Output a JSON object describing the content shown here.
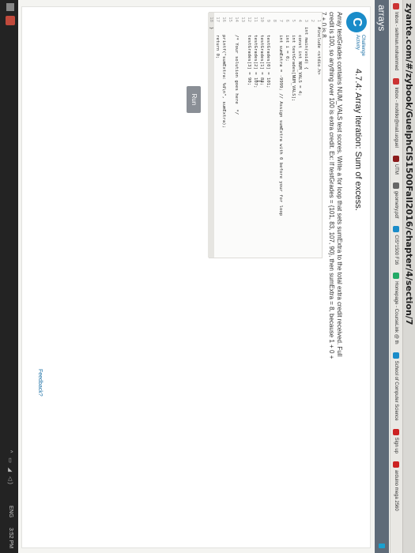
{
  "browser": {
    "url": "zyante.com/#/zybook/GuelphCIS1500Fall2016/chapter/4/section/7",
    "bookmarks": [
      {
        "label": "Inbox - seltman.mohammed",
        "color": "#c33"
      },
      {
        "label": "Inbox - mohitkr@mail.uoguel",
        "color": "#c33"
      },
      {
        "label": "UTM",
        "color": "#8b1b1b"
      },
      {
        "label": "geometry.pdf",
        "color": "#666"
      },
      {
        "label": "CIS*1500 F16",
        "color": "#1a8cc9"
      },
      {
        "label": "Homepage - CourseLink @ th",
        "color": "#2a6"
      },
      {
        "label": "School of Computer Science",
        "color": "#1a8cc9"
      },
      {
        "label": "Sign up",
        "color": "#c22"
      },
      {
        "label": "arduino mega 2560",
        "color": "#c22"
      }
    ]
  },
  "app": {
    "section": "arrays"
  },
  "challenge": {
    "badge": "C",
    "label_line1": "Challenge",
    "label_line2": "Activity",
    "title": "4.7.4: Array iteration: Sum of excess.",
    "description": "Array testGrades contains NUM_VALS test scores. Write a for loop that sets sumExtra to the total extra credit received. Full credit is 100, so anything over 100 is extra credit. Ex: If testGrades = {101, 83, 107, 90}, then sumExtra = 8, because 1 + 0 + 7 + 0 is 8."
  },
  "code": {
    "lines": [
      {
        "n": "1",
        "text": "#include <stdio.h>"
      },
      {
        "n": "2",
        "text": ""
      },
      {
        "n": "3",
        "text": "int main(void) {"
      },
      {
        "n": "4",
        "text": "   const int NUM_VALS = 4;"
      },
      {
        "n": "5",
        "text": "   int testGrades[NUM_VALS];"
      },
      {
        "n": "6",
        "text": "   int i = 0;"
      },
      {
        "n": "7",
        "text": "   int sumExtra = -9999; // Assign sumExtra with 0 before your for loop"
      },
      {
        "n": "8",
        "text": ""
      },
      {
        "n": "9",
        "text": "   testGrades[0] = 101;"
      },
      {
        "n": "10",
        "text": "   testGrades[1] = 83;"
      },
      {
        "n": "11",
        "text": "   testGrades[2] = 107;"
      },
      {
        "n": "12",
        "text": "   testGrades[3] = 90;"
      },
      {
        "n": "13",
        "text": ""
      },
      {
        "n": "14",
        "text": "   /* Your solution goes here  */"
      },
      {
        "n": "15",
        "text": ""
      },
      {
        "n": "16",
        "text": "   printf(\"sumExtra: %d\\n\", sumExtra);"
      },
      {
        "n": "17",
        "text": "   return 0;"
      },
      {
        "n": "18",
        "text": "}"
      }
    ]
  },
  "run_label": "Run",
  "feedback_label": "Feedback?",
  "taskbar": {
    "language": "ENG",
    "time": "3:52 PM"
  }
}
